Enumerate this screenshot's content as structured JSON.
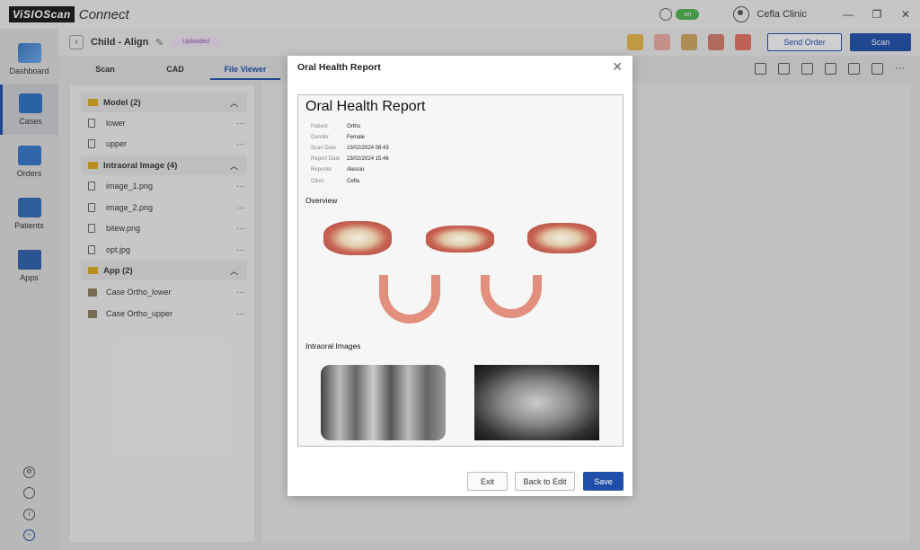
{
  "app": {
    "logo_box": "ViSIOScan",
    "logo_text": "Connect",
    "toggle": "on",
    "clinic": "Cefla Clinic"
  },
  "window": {
    "minimize": "—",
    "restore": "❐",
    "close": "✕"
  },
  "sidebar": {
    "items": [
      {
        "label": "Dashboard",
        "icon": "dashboard-icon"
      },
      {
        "label": "Cases",
        "icon": "cases-icon"
      },
      {
        "label": "Orders",
        "icon": "orders-icon"
      },
      {
        "label": "Patients",
        "icon": "patients-icon"
      },
      {
        "label": "Apps",
        "icon": "apps-icon"
      }
    ],
    "utilities": [
      "settings-icon",
      "globe-icon",
      "info-icon",
      "logout-icon"
    ]
  },
  "header": {
    "back": "‹",
    "title": "Child - Align",
    "status": "Uploaded",
    "send_order": "Send Order",
    "scan": "Scan"
  },
  "tabs": [
    {
      "label": "Scan"
    },
    {
      "label": "CAD"
    },
    {
      "label": "File Viewer"
    }
  ],
  "tree": {
    "groups": [
      {
        "label": "Model (2)",
        "files": [
          "lower",
          "upper"
        ]
      },
      {
        "label": "Intraoral Image (4)",
        "files": [
          "image_1.png",
          "image_2.png",
          "bitew.png",
          "opt.jpg"
        ]
      },
      {
        "label": "App (2)",
        "files": [
          "Case Ortho_lower",
          "Case Ortho_upper"
        ]
      }
    ],
    "more": "···"
  },
  "modal": {
    "title": "Oral Health Report",
    "close": "✕",
    "report": {
      "title": "Oral Health Report",
      "fields": [
        {
          "label": "Patient",
          "value": "Ortho"
        },
        {
          "label": "Gender",
          "value": "Female"
        },
        {
          "label": "Scan Date",
          "value": "23/02/2024 08:43"
        },
        {
          "label": "Report Date",
          "value": "23/02/2024 15:46"
        },
        {
          "label": "Reporter",
          "value": "Alessio"
        },
        {
          "label": "Clinic",
          "value": "Cefla"
        }
      ],
      "overview": "Overview",
      "intraoral": "Intraoral Images"
    },
    "buttons": {
      "exit": "Exit",
      "back_to_edit": "Back to Edit",
      "save": "Save"
    }
  },
  "colors": {
    "primary": "#1f4fa8",
    "folder": "#d9a520",
    "toggle_on": "#4caf50"
  }
}
